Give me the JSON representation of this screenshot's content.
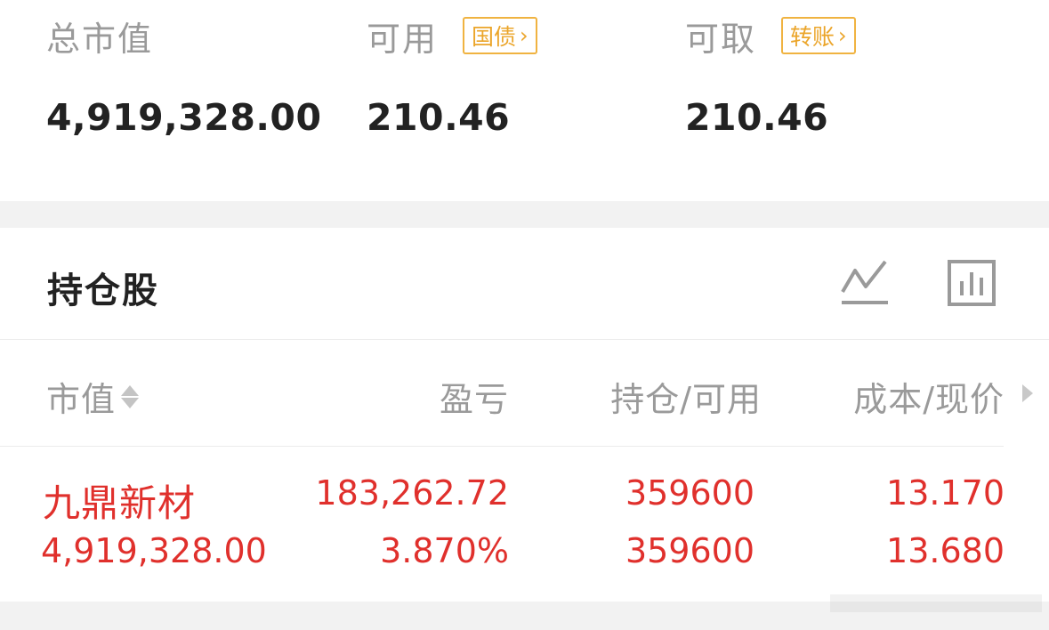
{
  "summary": {
    "total_market_value_label": "总市值",
    "total_market_value": "4,919,328.00",
    "available_label": "可用",
    "available_value": "210.46",
    "treasury_tag": "国债",
    "withdrawable_label": "可取",
    "withdrawable_value": "210.46",
    "transfer_tag": "转账"
  },
  "holdings": {
    "title": "持仓股",
    "columns": {
      "market_value": "市值",
      "profit_loss": "盈亏",
      "position_available": "持仓/可用",
      "cost_price": "成本/现价"
    },
    "rows": [
      {
        "name": "九鼎新材",
        "market_value": "4,919,328.00",
        "profit_loss": "183,262.72",
        "profit_loss_pct": "3.870%",
        "position": "359600",
        "available": "359600",
        "cost": "13.170",
        "price": "13.680"
      }
    ]
  },
  "icons": {
    "chevron": "chevron-right-icon",
    "trend": "trend-chart-icon",
    "bars": "bar-chart-icon",
    "sort": "sort-icon",
    "scroll": "scroll-right-icon"
  },
  "colors": {
    "accent_orange": "#eba52a",
    "profit_red": "#e0302c",
    "label_gray": "#9a9a9a",
    "text_dark": "#222222"
  }
}
